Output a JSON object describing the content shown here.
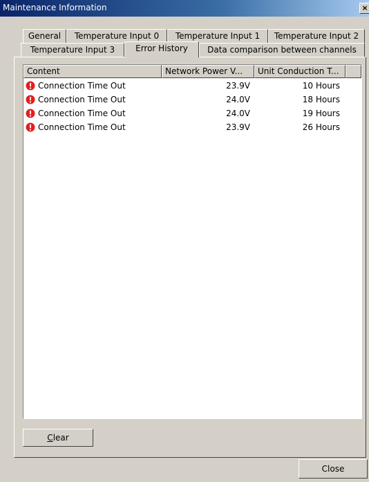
{
  "window": {
    "title": "Maintenance Information"
  },
  "tabs": {
    "row1": [
      "General",
      "Temperature Input 0",
      "Temperature Input 1",
      "Temperature Input 2"
    ],
    "row2": [
      "Temperature Input 3",
      "Error History",
      "Data comparison between channels"
    ],
    "active": "Error History"
  },
  "error_list": {
    "columns": [
      "Content",
      "Network Power V...",
      "Unit Conduction T..."
    ],
    "rows": [
      {
        "content": "Connection Time Out",
        "voltage": "23.9V",
        "hours": "10 Hours",
        "icon": "error-icon"
      },
      {
        "content": "Connection Time Out",
        "voltage": "24.0V",
        "hours": "18 Hours",
        "icon": "error-icon"
      },
      {
        "content": "Connection Time Out",
        "voltage": "24.0V",
        "hours": "19 Hours",
        "icon": "error-icon"
      },
      {
        "content": "Connection Time Out",
        "voltage": "23.9V",
        "hours": "26 Hours",
        "icon": "error-icon"
      }
    ]
  },
  "buttons": {
    "clear_first": "C",
    "clear_rest": "lear",
    "close": "Close"
  },
  "colors": {
    "error_icon": "#e02020",
    "titlebar": "#0a246a"
  }
}
